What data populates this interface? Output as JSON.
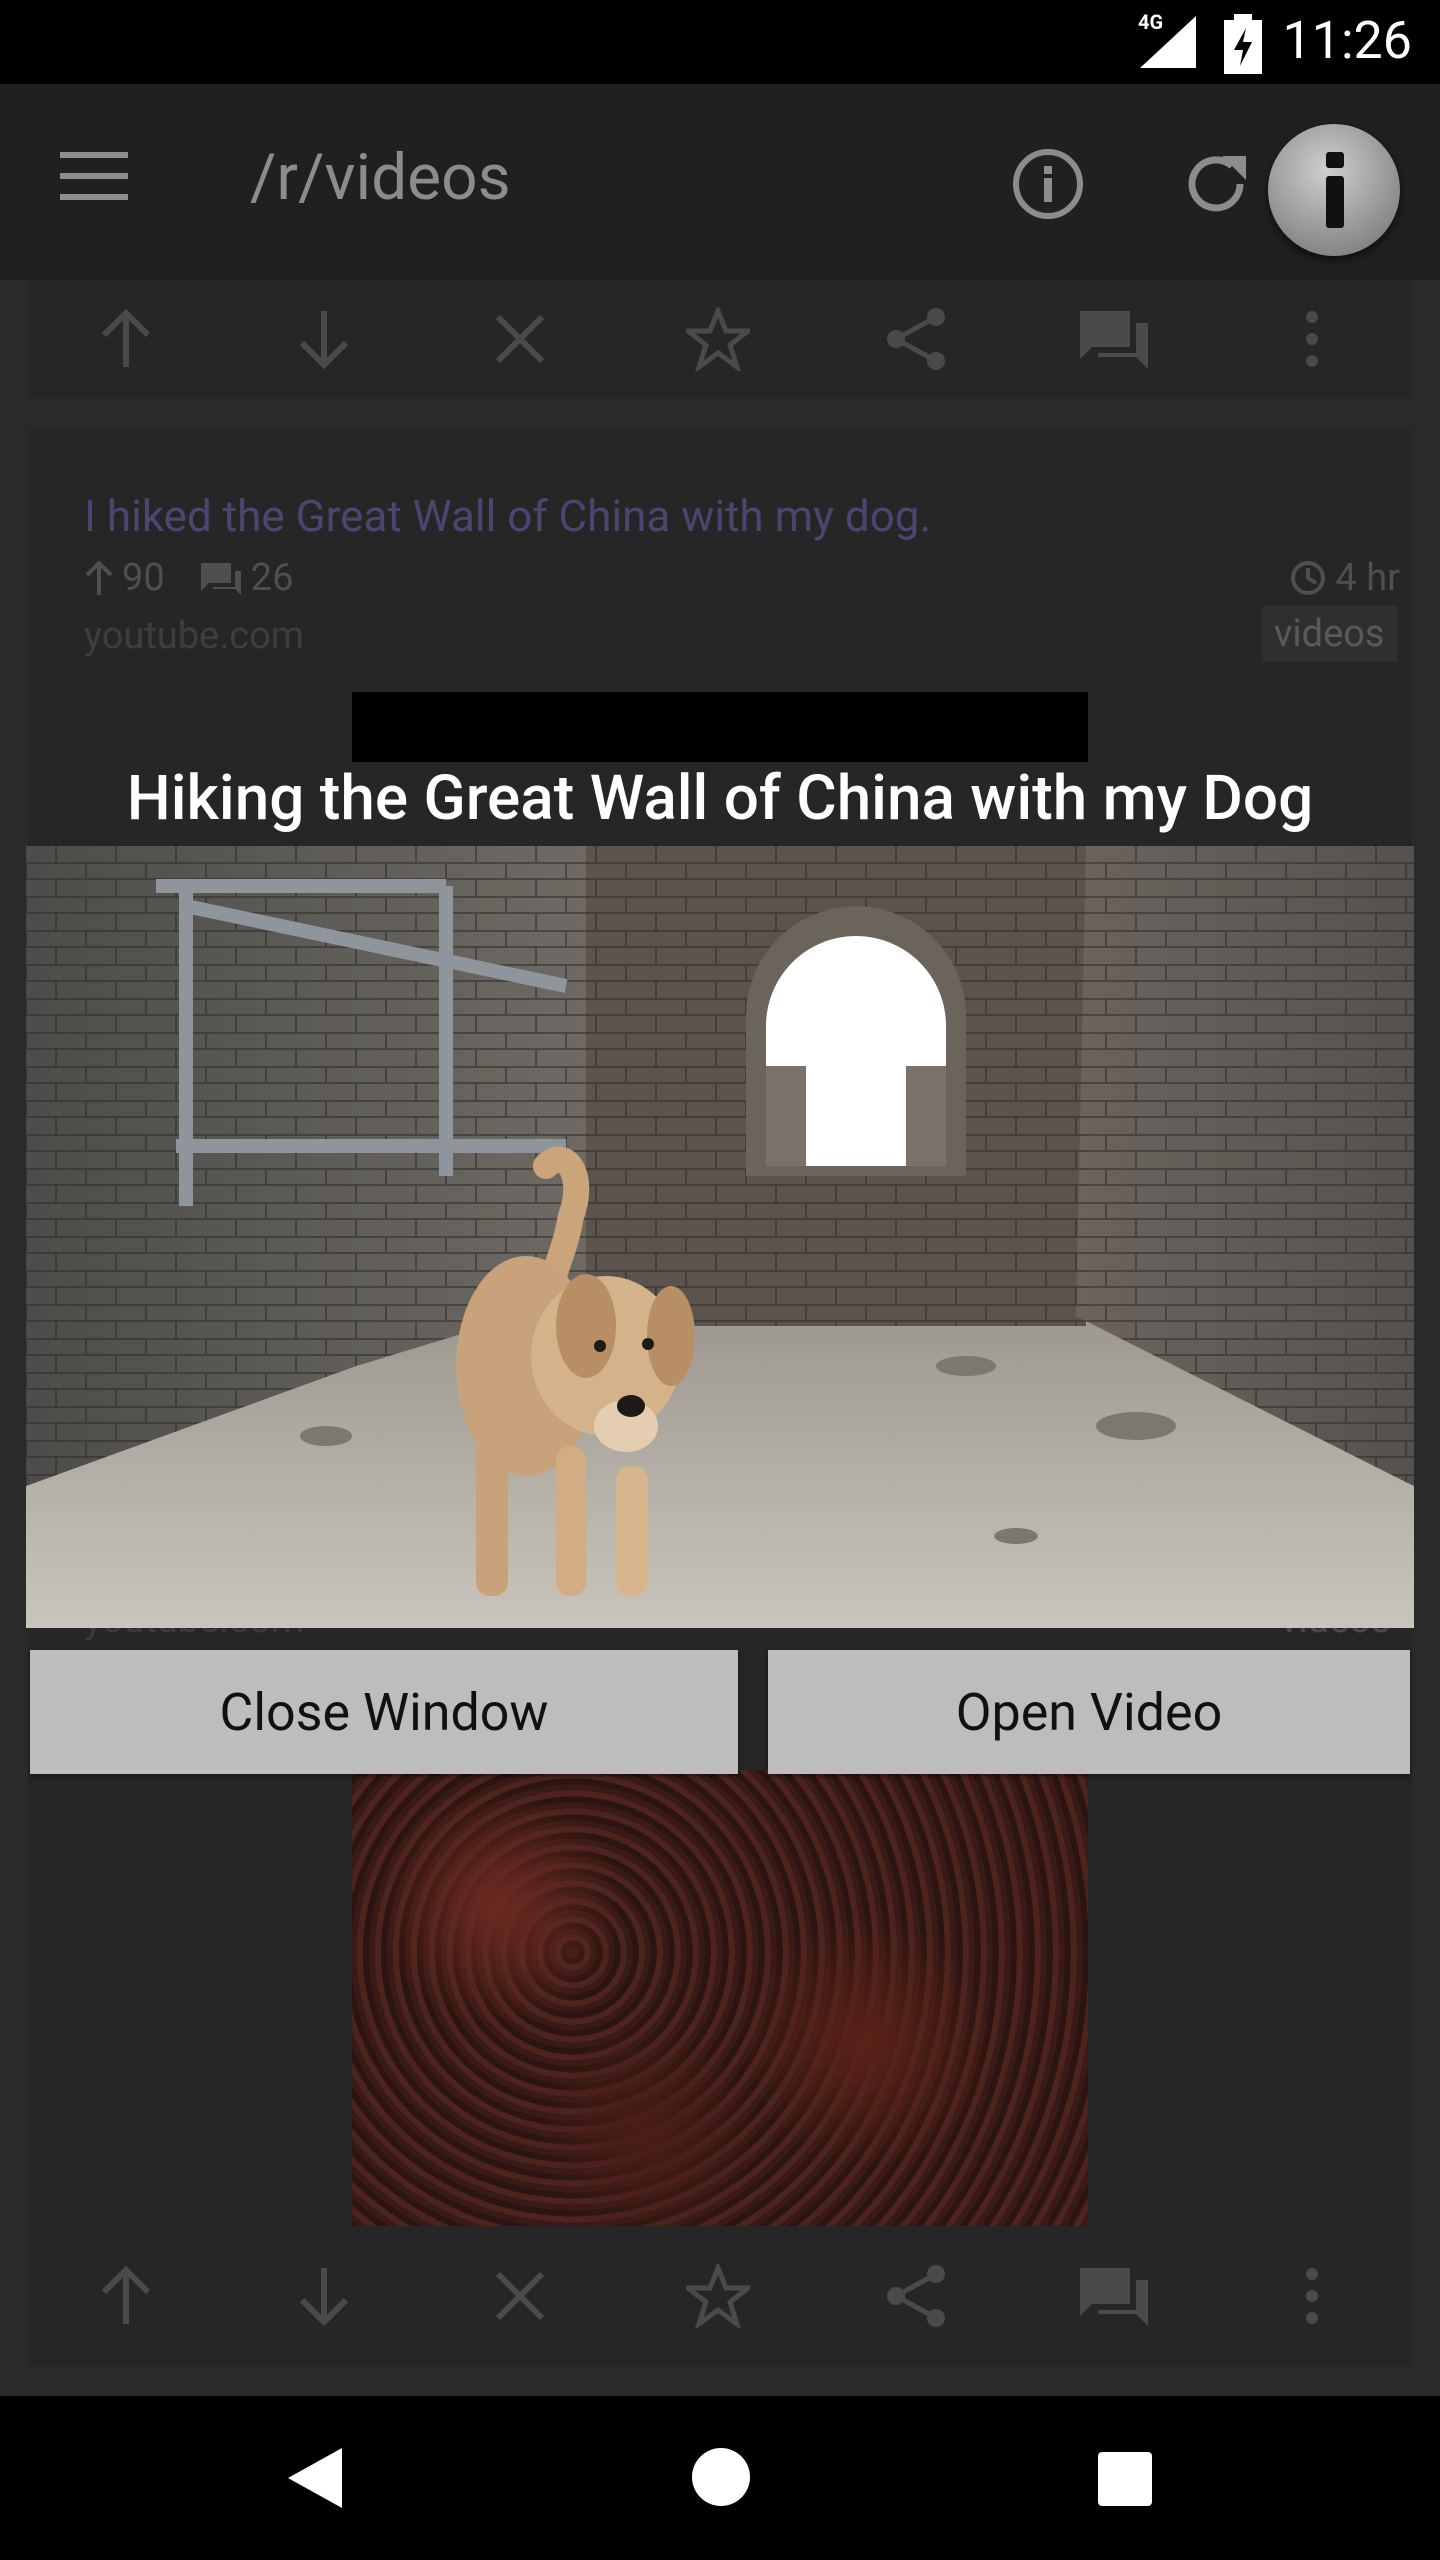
{
  "status_bar": {
    "time": "11:26",
    "network": "4G",
    "icons": [
      "signal-icon",
      "battery-charging-icon"
    ]
  },
  "toolbar": {
    "title": "/r/videos",
    "icons": [
      "menu-icon",
      "info-icon",
      "refresh-icon",
      "info-fab-icon"
    ]
  },
  "action_bar": {
    "icons": [
      "upvote-icon",
      "downvote-icon",
      "hide-icon",
      "star-icon",
      "share-icon",
      "comments-icon",
      "more-icon"
    ]
  },
  "post": {
    "title": "I hiked the Great Wall of China with my dog.",
    "score": "90",
    "comments": "26",
    "age": "4 hr",
    "domain": "youtube.com",
    "subreddit": "videos"
  },
  "dialog": {
    "video_title": "Hiking the Great Wall of China with my Dog",
    "close_label": "Close Window",
    "open_label": "Open Video"
  },
  "colors": {
    "background": "#2a2a2a",
    "toolbar": "#202020",
    "button": "#bdbdbd",
    "link": "#4a4670"
  }
}
